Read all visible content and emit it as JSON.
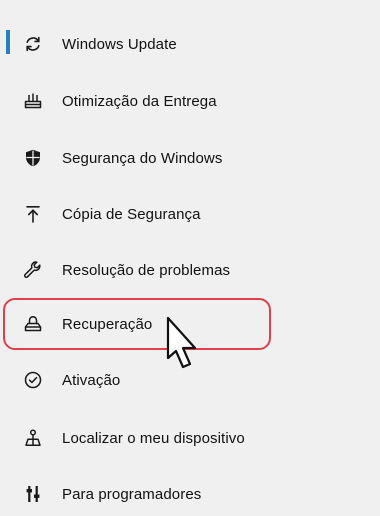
{
  "colors": {
    "accent": "#2a7fc4",
    "highlight": "#e0404a",
    "icon": "#1a1a1a"
  },
  "sidebar": {
    "items": [
      {
        "label": "Windows Update",
        "icon": "sync-icon",
        "active": true
      },
      {
        "label": "Otimização da Entrega",
        "icon": "delivery-optimization-icon",
        "active": false
      },
      {
        "label": "Segurança do Windows",
        "icon": "shield-icon",
        "active": false
      },
      {
        "label": "Cópia de Segurança",
        "icon": "upload-backup-icon",
        "active": false
      },
      {
        "label": "Resolução de problemas",
        "icon": "wrench-icon",
        "active": false
      },
      {
        "label": "Recuperação",
        "icon": "recovery-icon",
        "active": false,
        "highlighted": true
      },
      {
        "label": "Ativação",
        "icon": "check-circle-icon",
        "active": false
      },
      {
        "label": "Localizar o meu dispositivo",
        "icon": "find-device-icon",
        "active": false
      },
      {
        "label": "Para programadores",
        "icon": "developer-sliders-icon",
        "active": false
      }
    ]
  },
  "pointer": {
    "icon": "mouse-pointer-icon"
  }
}
